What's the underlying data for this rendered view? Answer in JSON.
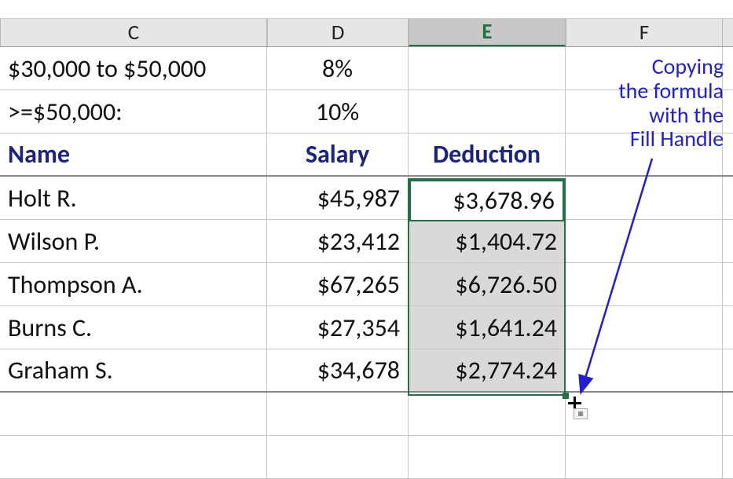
{
  "columns": {
    "C": "C",
    "D": "D",
    "E": "E",
    "F": "F"
  },
  "rules": [
    {
      "label": "$30,000 to $50,000",
      "pct": "8%"
    },
    {
      "label": ">=$50,000:",
      "pct": "10%"
    }
  ],
  "headers": {
    "name": "Name",
    "salary": "Salary",
    "deduction": "Deduction"
  },
  "rows": [
    {
      "name": "Holt R.",
      "salary": "$45,987",
      "deduction": "$3,678.96"
    },
    {
      "name": "Wilson P.",
      "salary": "$23,412",
      "deduction": "$1,404.72"
    },
    {
      "name": "Thompson A.",
      "salary": "$67,265",
      "deduction": "$6,726.50"
    },
    {
      "name": "Burns C.",
      "salary": "$27,354",
      "deduction": "$1,641.24"
    },
    {
      "name": "Graham S.",
      "salary": "$34,678",
      "deduction": "$2,774.24"
    }
  ],
  "annotation": {
    "line1": "Copying",
    "line2": "the formula",
    "line3": "with the",
    "line4": "Fill Handle"
  }
}
